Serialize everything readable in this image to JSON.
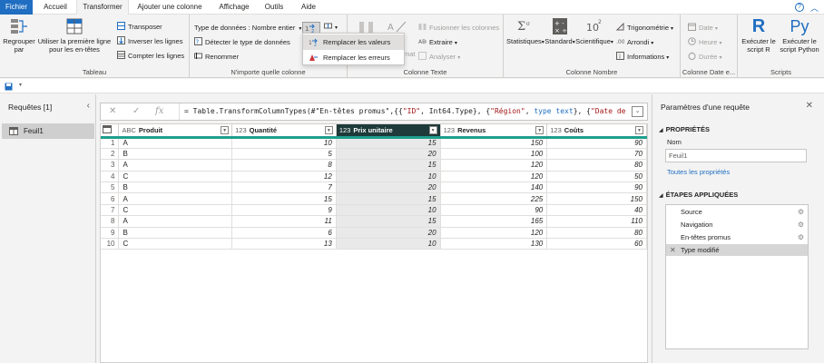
{
  "tabs": [
    "Fichier",
    "Accueil",
    "Transformer",
    "Ajouter une colonne",
    "Affichage",
    "Outils",
    "Aide"
  ],
  "ribbon": {
    "tableau": {
      "label": "Tableau",
      "grouper": "Regrouper par",
      "utiliser": "Utiliser la première ligne pour les en-têtes",
      "transposer": "Transposer",
      "inverser": "Inverser les lignes",
      "compter": "Compter les lignes"
    },
    "nimporte": {
      "label": "N'importe quelle colonne",
      "type_donnees": "Type de données : Nombre entier",
      "detecter": "Détecter le type de données",
      "renommer": "Renommer"
    },
    "texte": {
      "label": "Colonne Texte",
      "fusionner": "Fusionner les colonnes",
      "extraire": "Extraire",
      "analyser": "Analyser",
      "mat": "mat"
    },
    "nombre": {
      "label": "Colonne Nombre",
      "statistiques": "Statistiques",
      "standard": "Standard",
      "scientifique": "Scientifique",
      "trig": "Trigonométrie",
      "arrondi": "Arrondi",
      "informations": "Informations",
      "ten_base": "10",
      "ten_exp": "2"
    },
    "date": {
      "label": "Colonne Date e...",
      "date": "Date",
      "heure": "Heure",
      "duree": "Durée"
    },
    "scripts": {
      "label": "Scripts",
      "r": "Exécuter le script R",
      "python": "Exécuter le script Python",
      "r_glyph": "R",
      "py_glyph": "Py"
    }
  },
  "dropdown": {
    "remplacer_valeurs": "Remplacer les valeurs",
    "remplacer_erreurs": "Remplacer les erreurs"
  },
  "queries": {
    "title": "Requêtes [1]",
    "items": [
      "Feuil1"
    ]
  },
  "formula": {
    "prefix": "= Table.TransformColumnTypes(#\"En-têtes promus\",{{",
    "s1": "\"ID\"",
    "p2": ", Int64.Type}, {",
    "s2": "\"Région\"",
    "p3": ", ",
    "k3": "type text",
    "p4": "}, {",
    "s4": "\"Date de"
  },
  "grid": {
    "columns": [
      {
        "name": "Produit",
        "type": "ABC"
      },
      {
        "name": "Quantité",
        "type": "123"
      },
      {
        "name": "Prix unitaire",
        "type": "123"
      },
      {
        "name": "Revenus",
        "type": "123"
      },
      {
        "name": "Coûts",
        "type": "123"
      }
    ],
    "rows": [
      [
        "1",
        "A",
        "10",
        "15",
        "150",
        "90"
      ],
      [
        "2",
        "B",
        "5",
        "20",
        "100",
        "70"
      ],
      [
        "3",
        "A",
        "8",
        "15",
        "120",
        "80"
      ],
      [
        "4",
        "C",
        "12",
        "10",
        "120",
        "50"
      ],
      [
        "5",
        "B",
        "7",
        "20",
        "140",
        "90"
      ],
      [
        "6",
        "A",
        "15",
        "15",
        "225",
        "150"
      ],
      [
        "7",
        "C",
        "9",
        "10",
        "90",
        "40"
      ],
      [
        "8",
        "A",
        "11",
        "15",
        "165",
        "110"
      ],
      [
        "9",
        "B",
        "6",
        "20",
        "120",
        "80"
      ],
      [
        "10",
        "C",
        "13",
        "10",
        "130",
        "60"
      ]
    ],
    "first_cell_prefix": "²3"
  },
  "settings": {
    "title": "Paramètres d'une requête",
    "proprietes": "PROPRIÉTÉS",
    "nom_label": "Nom",
    "nom_value": "Feuil1",
    "toutes": "Toutes les propriétés",
    "etapes": "ÉTAPES APPLIQUÉES",
    "steps": [
      "Source",
      "Navigation",
      "En-têtes promus",
      "Type modifié"
    ]
  }
}
